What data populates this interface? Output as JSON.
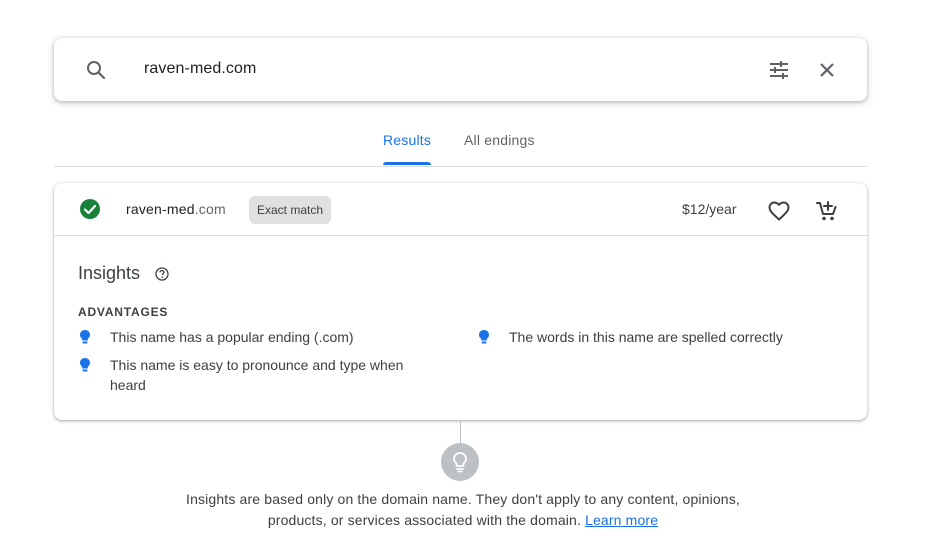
{
  "search": {
    "query": "raven-med.com"
  },
  "tabs": [
    {
      "label": "Results",
      "active": true
    },
    {
      "label": "All endings",
      "active": false
    }
  ],
  "result": {
    "domain_name": "raven-med",
    "domain_tld": ".com",
    "badge": "Exact match",
    "price": "$12/year"
  },
  "insights": {
    "title": "Insights",
    "advantages_label": "ADVANTAGES",
    "advantages": [
      "This name has a popular ending (.com)",
      "This name is easy to pronounce and type when heard",
      "The words in this name are spelled correctly"
    ]
  },
  "footer": {
    "line1": "Insights are based only on the domain name. They don't apply to any content, opinions,",
    "line2": "products, or services associated with the domain.",
    "link": "Learn more"
  },
  "colors": {
    "accent": "#1a73e8",
    "success": "#188038",
    "badge_bg": "#e0e0e0"
  },
  "icons": [
    "search-icon",
    "filter-icon",
    "close-icon",
    "check-circle-icon",
    "heart-icon",
    "add-to-cart-icon",
    "help-icon",
    "lightbulb-icon"
  ]
}
